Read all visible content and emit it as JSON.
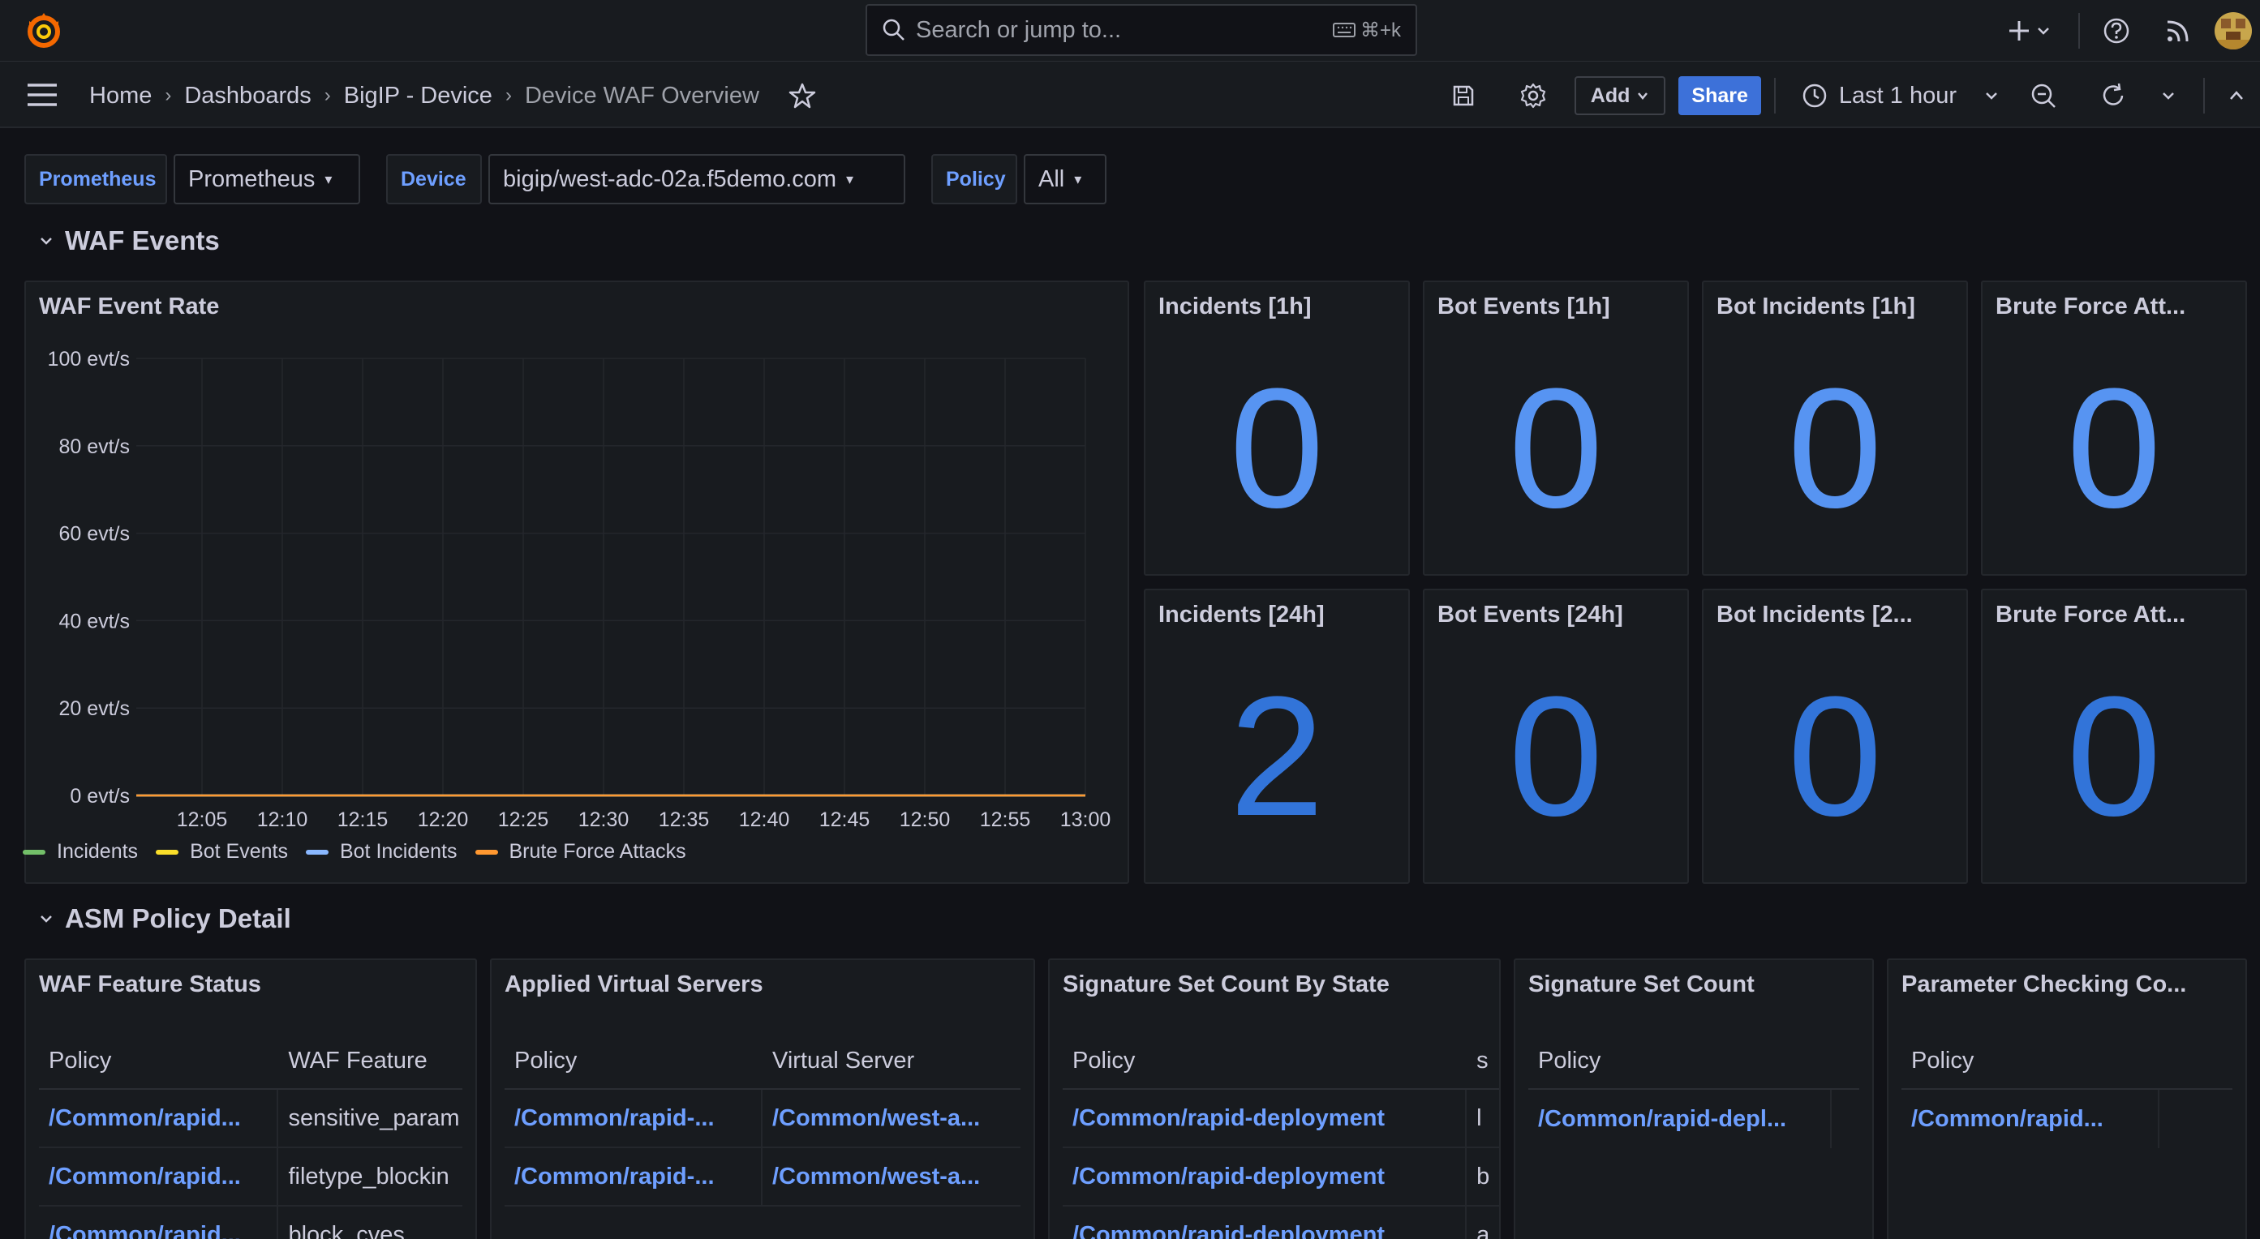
{
  "topbar": {
    "search_placeholder": "Search or jump to...",
    "search_shortcut": "⌘+k"
  },
  "breadcrumbs": [
    "Home",
    "Dashboards",
    "BigIP - Device",
    "Device WAF Overview"
  ],
  "toolbar": {
    "add_label": "Add",
    "share_label": "Share",
    "time_range": "Last 1 hour"
  },
  "variables": {
    "datasource_label": "Prometheus",
    "datasource_value": "Prometheus",
    "device_label": "Device",
    "device_value": "bigip/west-adc-02a.f5demo.com",
    "policy_label": "Policy",
    "policy_value": "All"
  },
  "rows": {
    "waf_events": "WAF Events",
    "asm_policy": "ASM Policy Detail"
  },
  "chart_panel": {
    "title": "WAF Event Rate"
  },
  "chart_data": {
    "type": "line",
    "title": "WAF Event Rate",
    "x": [
      "12:05",
      "12:10",
      "12:15",
      "12:20",
      "12:25",
      "12:30",
      "12:35",
      "12:40",
      "12:45",
      "12:50",
      "12:55",
      "13:00"
    ],
    "y_ticks": [
      "0 evt/s",
      "20 evt/s",
      "40 evt/s",
      "60 evt/s",
      "80 evt/s",
      "100 evt/s"
    ],
    "ylim": [
      0,
      100
    ],
    "grid": true,
    "legend_position": "bottom",
    "series": [
      {
        "name": "Incidents",
        "color": "#73bf69",
        "values": [
          0,
          0,
          0,
          0,
          0,
          0,
          0,
          0,
          0,
          0,
          0,
          0
        ]
      },
      {
        "name": "Bot Events",
        "color": "#fade2a",
        "values": [
          0,
          0,
          0,
          0,
          0,
          0,
          0,
          0,
          0,
          0,
          0,
          0
        ]
      },
      {
        "name": "Bot Incidents",
        "color": "#8ab8ff",
        "values": [
          0,
          0,
          0,
          0,
          0,
          0,
          0,
          0,
          0,
          0,
          0,
          0
        ]
      },
      {
        "name": "Brute Force Attacks",
        "color": "#ff9830",
        "values": [
          0,
          0,
          0,
          0,
          0,
          0,
          0,
          0,
          0,
          0,
          0,
          0
        ]
      }
    ]
  },
  "stats": [
    {
      "title": "Incidents [1h]",
      "value": "0",
      "color": "#5794f2"
    },
    {
      "title": "Bot Events [1h]",
      "value": "0",
      "color": "#5794f2"
    },
    {
      "title": "Bot Incidents [1h]",
      "value": "0",
      "color": "#5794f2"
    },
    {
      "title": "Brute Force Att...",
      "value": "0",
      "color": "#5794f2"
    },
    {
      "title": "Incidents [24h]",
      "value": "2",
      "color": "#3274d9"
    },
    {
      "title": "Bot Events [24h]",
      "value": "0",
      "color": "#3274d9"
    },
    {
      "title": "Bot Incidents [2...",
      "value": "0",
      "color": "#3274d9"
    },
    {
      "title": "Brute Force Att...",
      "value": "0",
      "color": "#3274d9"
    }
  ],
  "tables": {
    "waf_feature": {
      "title": "WAF Feature Status",
      "headers": [
        "Policy",
        "WAF Feature"
      ],
      "rows": [
        [
          "/Common/rapid...",
          "sensitive_param"
        ],
        [
          "/Common/rapid...",
          "filetype_blockin"
        ],
        [
          "/Common/rapid...",
          "block_cves"
        ]
      ]
    },
    "virtual_servers": {
      "title": "Applied Virtual Servers",
      "headers": [
        "Policy",
        "Virtual Server"
      ],
      "rows": [
        [
          "/Common/rapid-...",
          "/Common/west-a..."
        ],
        [
          "/Common/rapid-...",
          "/Common/west-a..."
        ]
      ]
    },
    "sig_by_state": {
      "title": "Signature Set Count By State",
      "headers": [
        "Policy",
        "s"
      ],
      "rows": [
        [
          "/Common/rapid-deployment",
          "l"
        ],
        [
          "/Common/rapid-deployment",
          "b"
        ],
        [
          "/Common/rapid-deployment",
          "a"
        ]
      ]
    },
    "sig_count": {
      "title": "Signature Set Count",
      "headers": [
        "Policy"
      ],
      "rows": [
        [
          "/Common/rapid-depl..."
        ]
      ]
    },
    "param_checking": {
      "title": "Parameter Checking Co...",
      "headers": [
        "Policy"
      ],
      "rows": [
        [
          "/Common/rapid..."
        ]
      ]
    }
  }
}
